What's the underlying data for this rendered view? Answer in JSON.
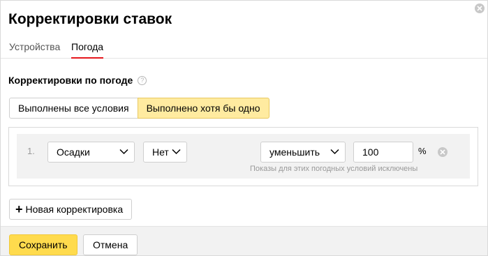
{
  "dialog": {
    "title": "Корректировки ставок",
    "close_icon": "close-icon"
  },
  "tabs": [
    {
      "label": "Устройства",
      "active": false
    },
    {
      "label": "Погода",
      "active": true
    }
  ],
  "section": {
    "title": "Корректировки по погоде",
    "help_icon": "question-icon",
    "help_glyph": "?"
  },
  "condition_mode": {
    "options": [
      "Выполнены все условия",
      "Выполнено хотя бы одно"
    ],
    "selected": "Выполнено хотя бы одно"
  },
  "rules": [
    {
      "number": "1.",
      "parameter": "Осадки",
      "value": "Нет",
      "action": "уменьшить",
      "amount": "100",
      "unit": "%",
      "hint": "Показы для этих погодных условий исключены"
    }
  ],
  "add_button": {
    "label": "Новая корректировка",
    "icon": "plus-icon",
    "glyph": "+"
  },
  "footer": {
    "save_label": "Сохранить",
    "cancel_label": "Отмена"
  },
  "colors": {
    "accent": "#ffdb4d",
    "active_segment": "#ffeba0",
    "tab_underline": "#e5171d"
  }
}
